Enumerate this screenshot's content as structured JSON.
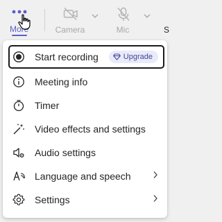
{
  "toolbar": {
    "more": {
      "label": "More",
      "icon": "more-dots-icon",
      "accent": "#5b5fc7"
    },
    "camera": {
      "label": "Camera",
      "icon": "camera-off-icon",
      "state": "disabled"
    },
    "mic": {
      "label": "Mic",
      "icon": "mic-off-icon",
      "state": "disabled"
    },
    "cut_label": "S"
  },
  "menu": {
    "items": [
      {
        "label": "Start recording",
        "icon": "record-icon",
        "badge": "Upgrade",
        "badge_icon": "diamond-icon"
      },
      {
        "label": "Meeting info",
        "icon": "info-icon"
      },
      {
        "label": "Timer",
        "icon": "timer-icon"
      },
      {
        "label": "Video effects and settings",
        "icon": "video-effects-icon"
      },
      {
        "label": "Audio settings",
        "icon": "speaker-settings-icon"
      },
      {
        "label": "Language and speech",
        "icon": "language-icon",
        "submenu": true
      },
      {
        "label": "Settings",
        "icon": "gear-icon",
        "submenu": true
      }
    ]
  }
}
